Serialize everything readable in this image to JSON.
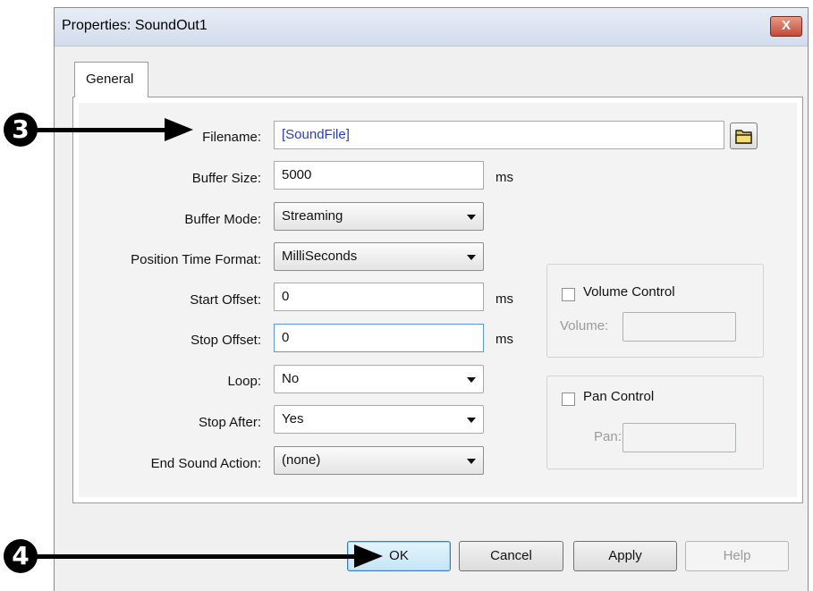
{
  "window": {
    "title": "Properties: SoundOut1",
    "close_label": "X"
  },
  "tabs": [
    {
      "label": "General",
      "selected": true
    }
  ],
  "form": {
    "filename": {
      "label": "Filename:",
      "value": "[SoundFile]",
      "browse_icon": "folder-icon"
    },
    "buffer_size": {
      "label": "Buffer Size:",
      "value": "5000",
      "unit": "ms"
    },
    "buffer_mode": {
      "label": "Buffer Mode:",
      "value": "Streaming"
    },
    "position_time_format": {
      "label": "Position Time Format:",
      "value": "MilliSeconds"
    },
    "start_offset": {
      "label": "Start Offset:",
      "value": "0",
      "unit": "ms"
    },
    "stop_offset": {
      "label": "Stop Offset:",
      "value": "0",
      "unit": "ms"
    },
    "loop": {
      "label": "Loop:",
      "value": "No"
    },
    "stop_after": {
      "label": "Stop After:",
      "value": "Yes"
    },
    "end_sound_action": {
      "label": "End Sound Action:",
      "value": "(none)"
    }
  },
  "volume_control": {
    "label": "Volume Control",
    "checked": false,
    "field_label": "Volume:",
    "value": ""
  },
  "pan_control": {
    "label": "Pan Control",
    "checked": false,
    "field_label": "Pan:",
    "value": ""
  },
  "buttons": {
    "ok": "OK",
    "cancel": "Cancel",
    "apply": "Apply",
    "help": "Help"
  },
  "callouts": [
    {
      "number": "3",
      "target": "filename"
    },
    {
      "number": "4",
      "target": "ok"
    }
  ],
  "colors": {
    "title_bar": "#d3dced",
    "close_button": "#c24a36",
    "default_button": "#c4e5f6",
    "filename_text": "#2b3bbf"
  }
}
